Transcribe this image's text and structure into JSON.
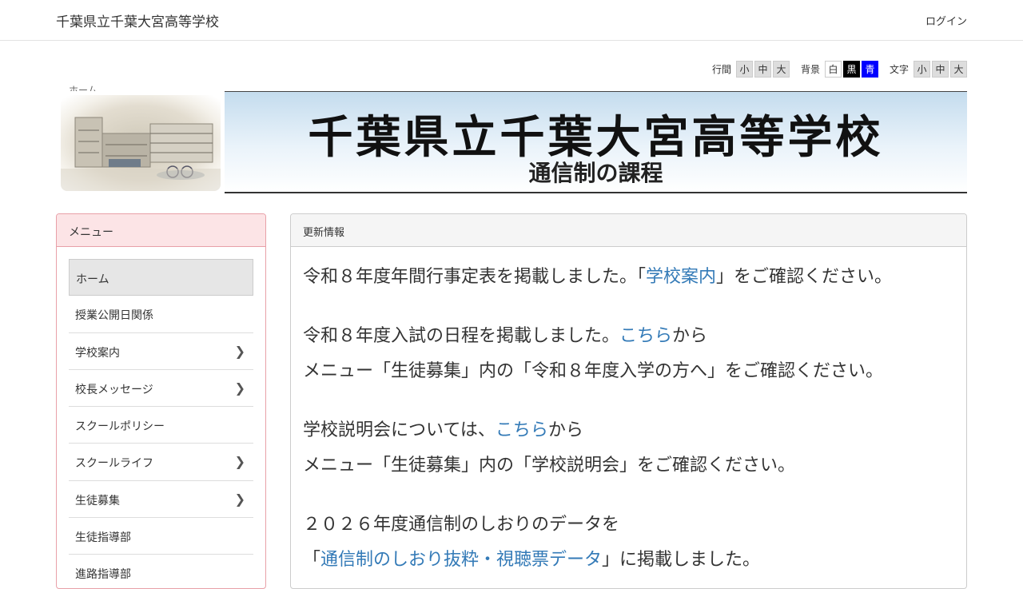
{
  "header": {
    "site_name": "千葉県立千葉大宮高等学校",
    "login_label": "ログイン"
  },
  "a11y": {
    "line_label": "行間",
    "bg_label": "背景",
    "text_label": "文字",
    "line_options": [
      "小",
      "中",
      "大"
    ],
    "bg_options": [
      "白",
      "黒",
      "青"
    ],
    "text_options": [
      "小",
      "中",
      "大"
    ]
  },
  "breadcrumb": {
    "home": "ホーム"
  },
  "banner": {
    "title": "千葉県立千葉大宮高等学校",
    "subtitle": "通信制の課程"
  },
  "menu": {
    "heading": "メニュー",
    "items": [
      {
        "label": "ホーム",
        "has_children": false
      },
      {
        "label": "授業公開日関係",
        "has_children": false
      },
      {
        "label": "学校案内",
        "has_children": true
      },
      {
        "label": "校長メッセージ",
        "has_children": true
      },
      {
        "label": "スクールポリシー",
        "has_children": false
      },
      {
        "label": "スクールライフ",
        "has_children": true
      },
      {
        "label": "生徒募集",
        "has_children": true
      },
      {
        "label": "生徒指導部",
        "has_children": false
      },
      {
        "label": "進路指導部",
        "has_children": false
      }
    ]
  },
  "content": {
    "heading": "更新情報",
    "p1": {
      "pre": "令和８年度年間行事定表を掲載しました。「",
      "link": "学校案内",
      "post": "」をご確認ください。"
    },
    "p2": {
      "pre": "令和８年度入試の日程を掲載しました。",
      "link": "こちら",
      "post": "から",
      "line2": "メニュー「生徒募集」内の「令和８年度入学の方へ」をご確認ください。"
    },
    "p3": {
      "pre": "学校説明会については、",
      "link": "こちら",
      "post": "から",
      "line2": "メニュー「生徒募集」内の「学校説明会」をご確認ください。"
    },
    "p4": {
      "line1": "２０２６年度通信制のしおりのデータを",
      "pre": "「",
      "link": "通信制のしおり抜粋・視聴票データ",
      "post": "」に掲載しました。"
    }
  },
  "colors": {
    "menu_border": "#e8a0a8",
    "menu_heading_bg": "#fce4e6",
    "link": "#337ab7",
    "bg_black_btn": "#000000",
    "bg_blue_btn": "#0000ff"
  }
}
